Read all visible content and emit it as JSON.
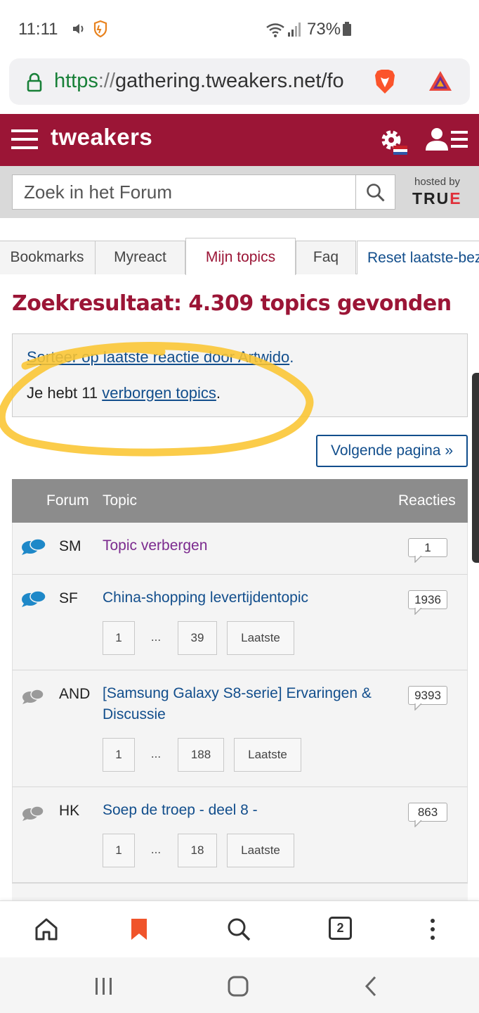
{
  "status_bar": {
    "time": "11:11",
    "battery": "73%"
  },
  "browser": {
    "url_scheme": "https",
    "url_sep": "://",
    "url_rest": "gathering.tweakers.net/fo",
    "tabs_count": "2"
  },
  "site": {
    "logo": "tweakers"
  },
  "search": {
    "placeholder": "Zoek in het Forum",
    "hosted_by": "hosted by",
    "sponsor_main": "TRU",
    "sponsor_end": "E"
  },
  "tabs": [
    {
      "label": "Bookmarks"
    },
    {
      "label": "Myreact"
    },
    {
      "label": "Mijn topics"
    },
    {
      "label": "Faq"
    },
    {
      "label": "Reset laatste-bez"
    }
  ],
  "result_title": "Zoekresultaat: 4.309 topics gevonden",
  "info": {
    "sort_link": "Sorteer op laatste reactie door Artwido",
    "sort_end": ".",
    "hidden_prefix": "Je hebt 11 ",
    "hidden_link": "verborgen topics",
    "hidden_end": "."
  },
  "next_page": "Volgende pagina »",
  "table": {
    "headers": {
      "forum": "Forum",
      "topic": "Topic",
      "reactions": "Reacties"
    },
    "rows": [
      {
        "forum": "SM",
        "title": "Topic verbergen",
        "count": "1"
      },
      {
        "forum": "SF",
        "title": "China-shopping levertijdentopic",
        "count": "1936",
        "pager": [
          "1",
          "...",
          "39",
          "Laatste"
        ]
      },
      {
        "forum": "AND",
        "title": "[Samsung Galaxy S8-serie] Ervaringen & Discussie",
        "count": "9393",
        "pager": [
          "1",
          "...",
          "188",
          "Laatste"
        ]
      },
      {
        "forum": "HK",
        "title": "Soep de troep - deel 8 -",
        "count": "863",
        "pager": [
          "1",
          "...",
          "18",
          "Laatste"
        ]
      }
    ]
  },
  "colors": {
    "brand": "#9b1536",
    "link": "#124e8c",
    "visited": "#7b2a8e",
    "accent_bookmark": "#f0542b"
  }
}
